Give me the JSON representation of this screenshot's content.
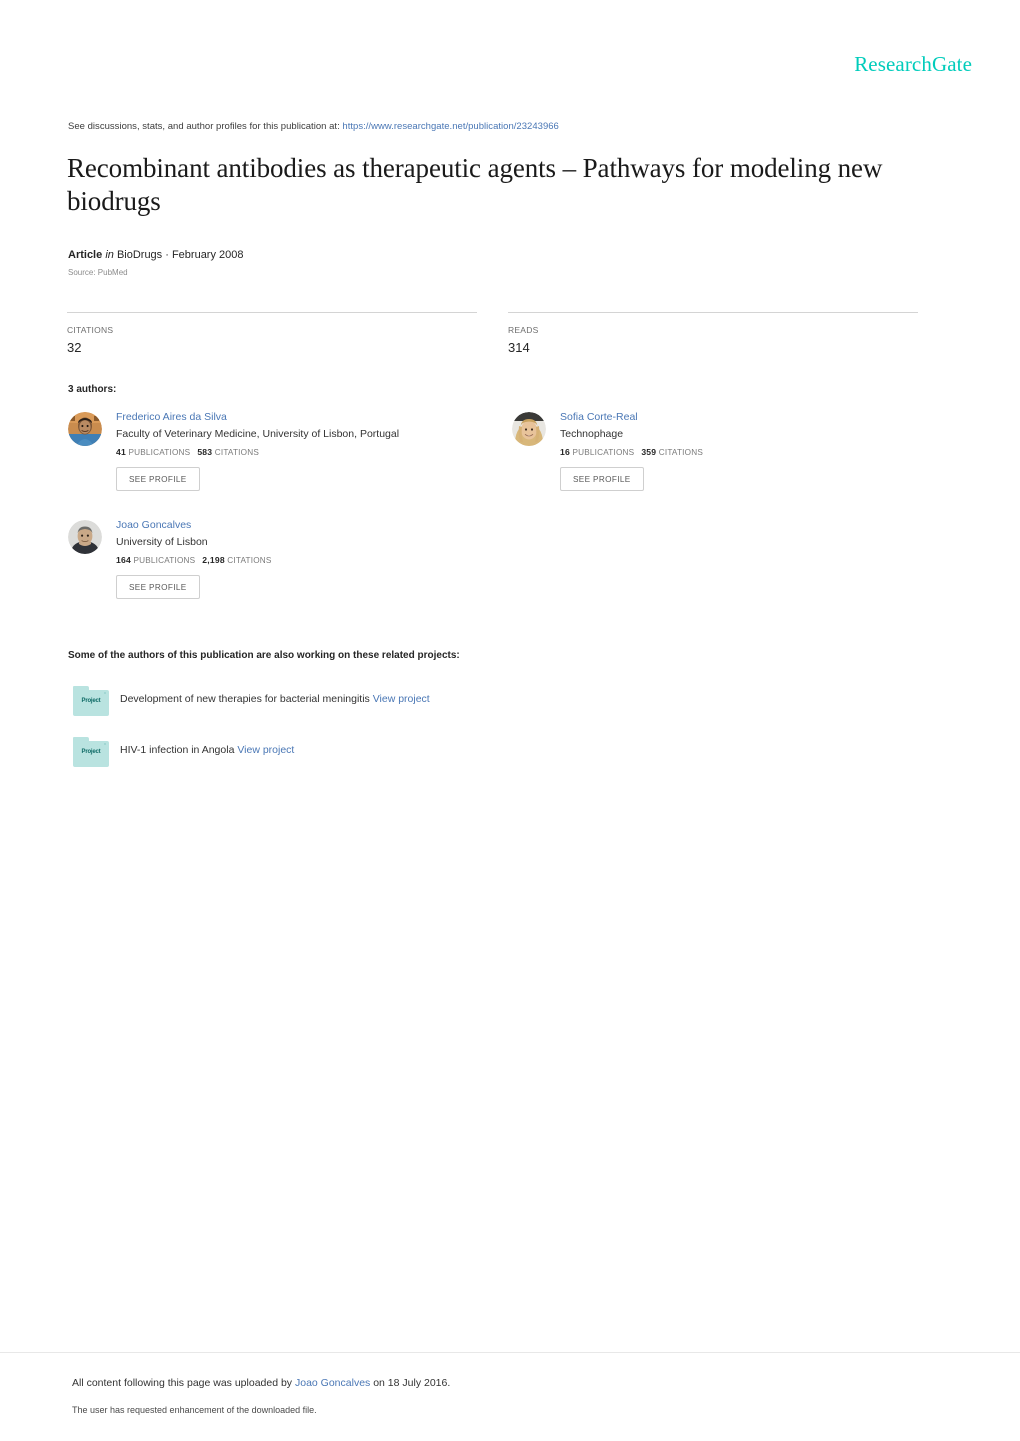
{
  "brand": {
    "name": "ResearchGate",
    "color": "#00ccbb"
  },
  "discussions": {
    "prefix": "See discussions, stats, and author profiles for this publication at:",
    "url": "https://www.researchgate.net/publication/23243966"
  },
  "publication": {
    "title": "Recombinant antibodies as therapeutic agents – Pathways for modeling new biodrugs",
    "type_label": "Article",
    "in_word": "in",
    "venue": "BioDrugs · February 2008",
    "source": "Source: PubMed"
  },
  "stats": {
    "citations_label": "CITATIONS",
    "citations_value": "32",
    "reads_label": "READS",
    "reads_value": "314"
  },
  "authors_section": {
    "heading": "3 authors:",
    "publications_word": "PUBLICATIONS",
    "citations_word": "CITATIONS",
    "see_profile_label": "SEE PROFILE",
    "authors": [
      {
        "name": "Frederico Aires da Silva",
        "affiliation": "Faculty of Veterinary Medicine, University of Lisbon, Portugal",
        "publications": "41",
        "citations": "583"
      },
      {
        "name": "Sofia Corte-Real",
        "affiliation": "Technophage",
        "publications": "16",
        "citations": "359"
      },
      {
        "name": "Joao Goncalves",
        "affiliation": "University of Lisbon",
        "publications": "164",
        "citations": "2,198"
      }
    ]
  },
  "projects_section": {
    "heading": "Some of the authors of this publication are also working on these related projects:",
    "icon_label": "Project",
    "view_label": "View project",
    "projects": [
      {
        "title": "Development of new therapies for bacterial meningitis"
      },
      {
        "title": "HIV-1 infection in Angola"
      }
    ]
  },
  "footer": {
    "upload_prefix": "All content following this page was uploaded by",
    "uploader": "Joao Goncalves",
    "upload_suffix": "on 18 July 2016.",
    "enhancement_note": "The user has requested enhancement of the downloaded file."
  }
}
